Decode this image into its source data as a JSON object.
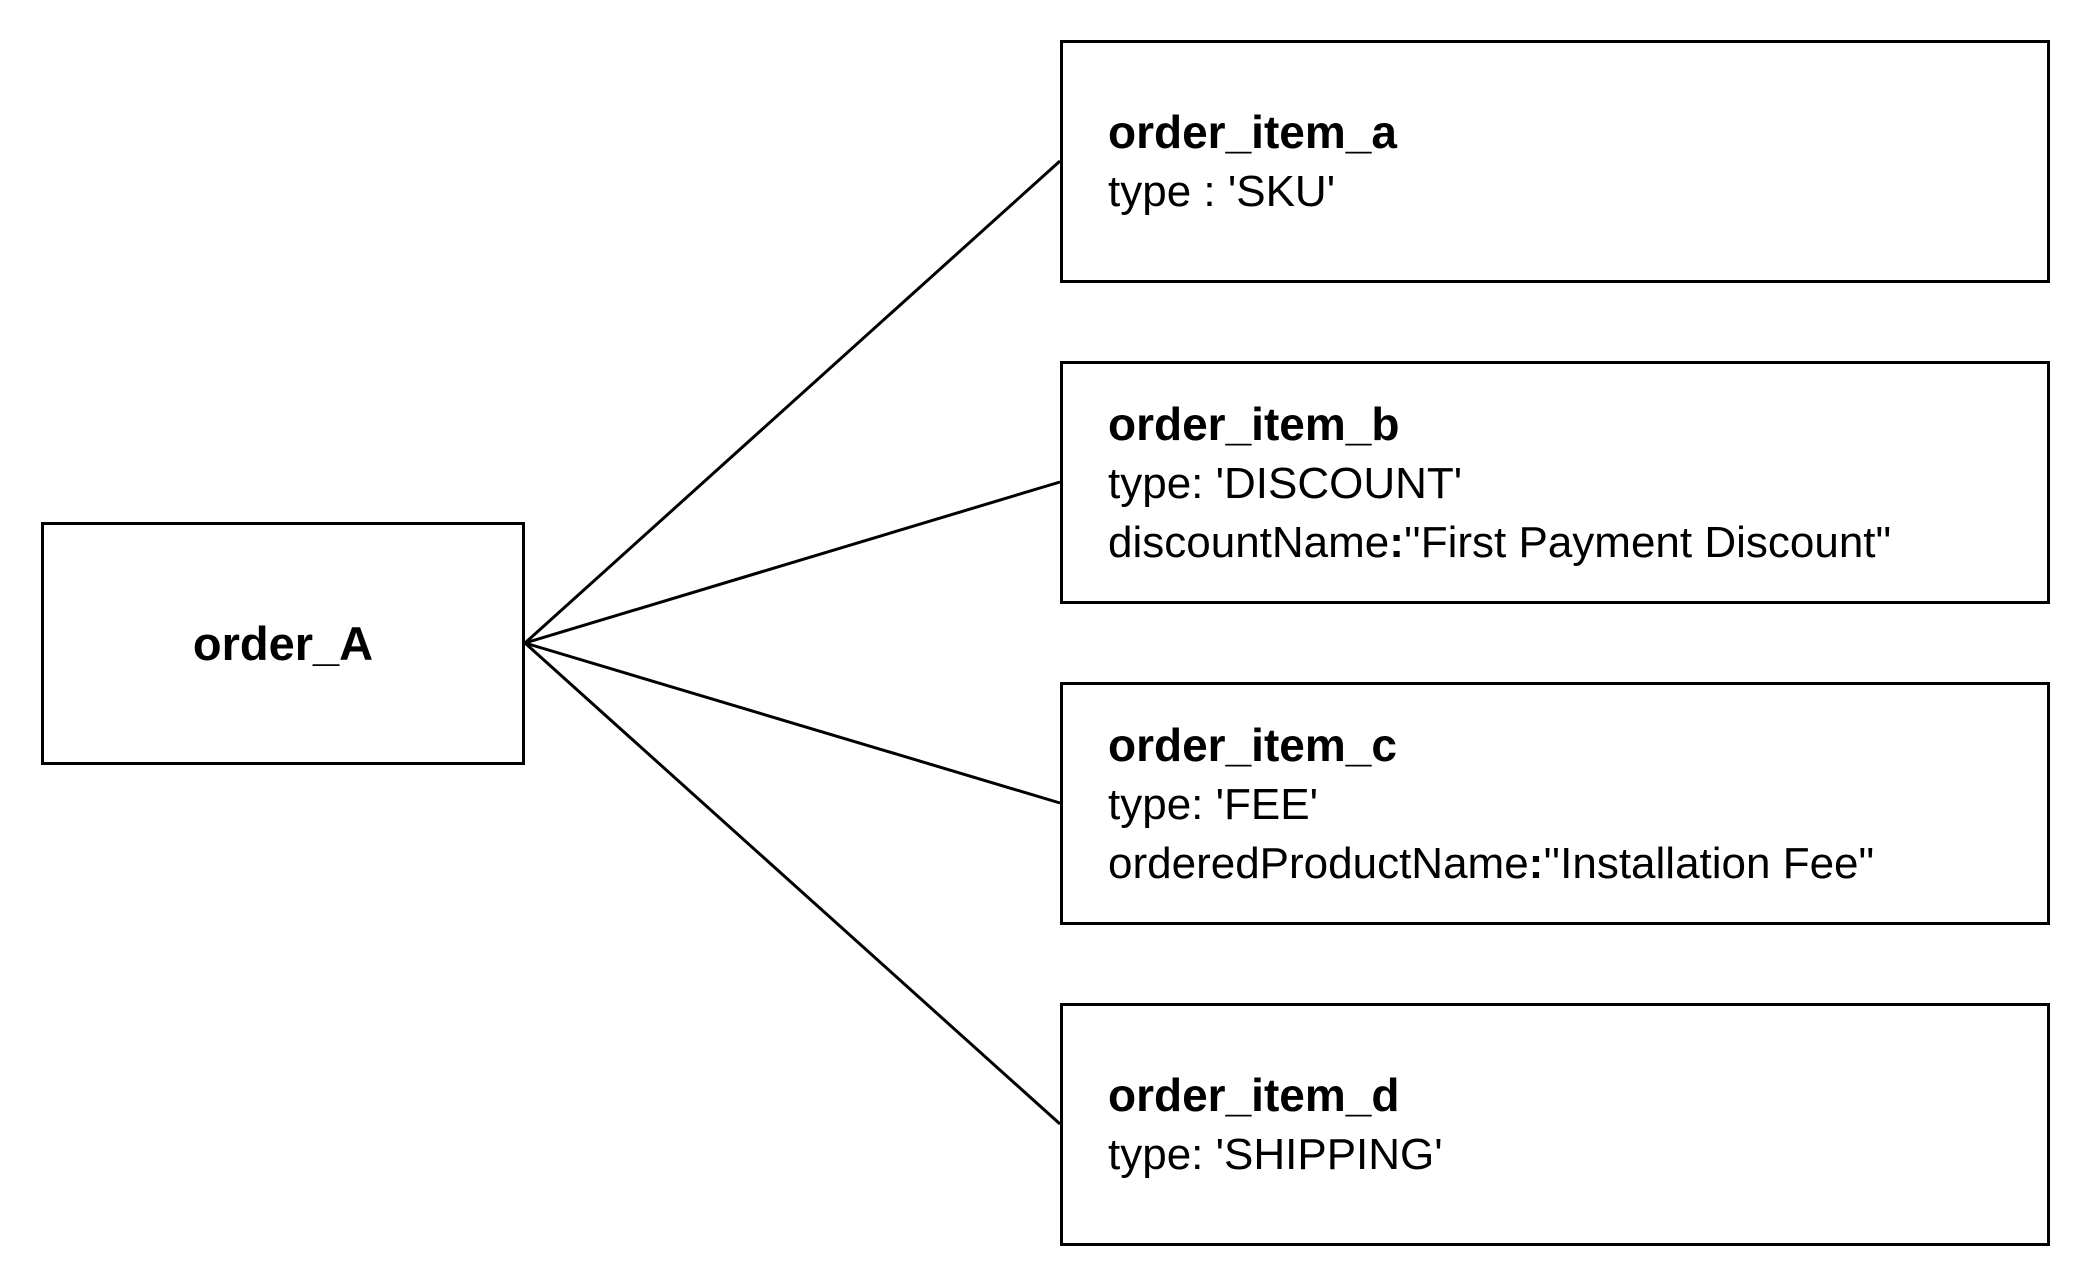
{
  "root": {
    "label": "order_A"
  },
  "items": [
    {
      "name": "order_item_a",
      "attributes": [
        {
          "text": "type : 'SKU'"
        }
      ]
    },
    {
      "name": "order_item_b",
      "attributes": [
        {
          "text": "type: 'DISCOUNT'"
        },
        {
          "key": "discountName",
          "sep": ":",
          "value": "''First Payment Discount\""
        }
      ]
    },
    {
      "name": "order_item_c",
      "attributes": [
        {
          "text": "type: 'FEE'"
        },
        {
          "key": "orderedProductName",
          "sep": ":",
          "value": "''Installation Fee\""
        }
      ]
    },
    {
      "name": "order_item_d",
      "attributes": [
        {
          "text": "type: 'SHIPPING'"
        }
      ]
    }
  ]
}
